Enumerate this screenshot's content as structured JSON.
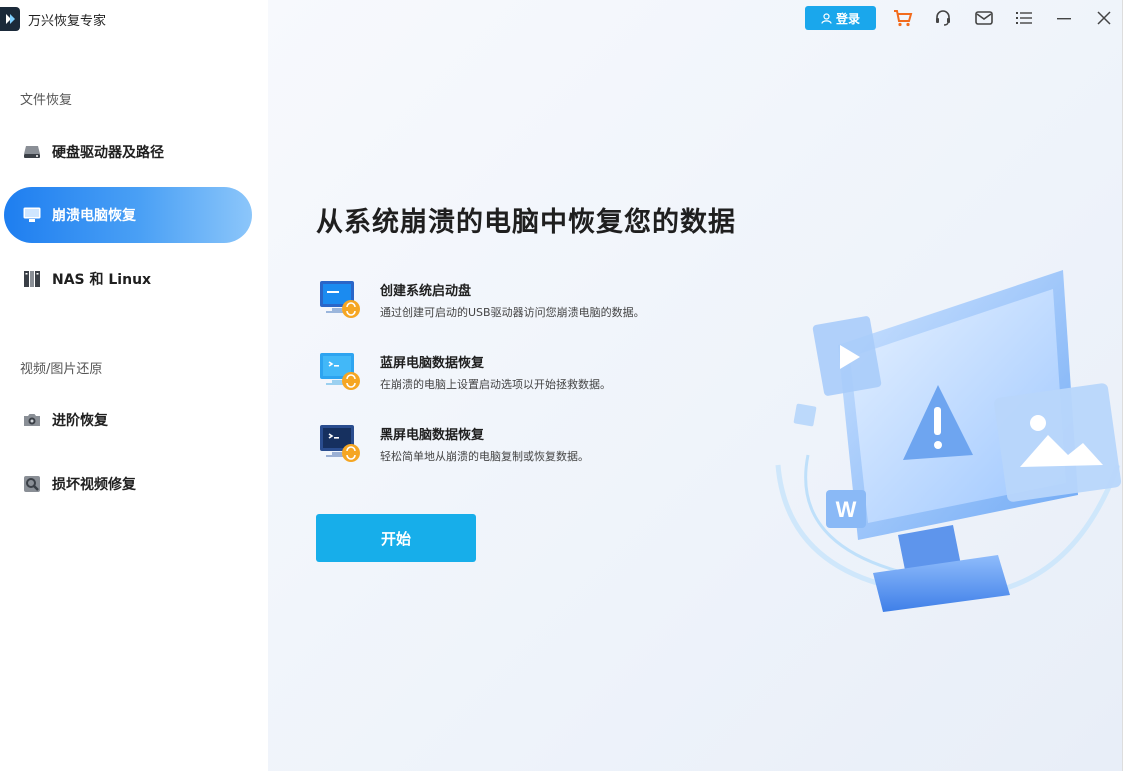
{
  "app": {
    "title": "万兴恢复专家"
  },
  "sidebar": {
    "section_file": "文件恢复",
    "section_media": "视频/图片还原",
    "items": [
      {
        "label": "硬盘驱动器及路径",
        "icon": "hard-drive-icon"
      },
      {
        "label": "崩溃电脑恢复",
        "icon": "monitor-icon",
        "active": true
      },
      {
        "label": "NAS 和 Linux",
        "icon": "nas-icon"
      },
      {
        "label": "进阶恢复",
        "icon": "camera-icon"
      },
      {
        "label": "损坏视频修复",
        "icon": "video-repair-icon"
      }
    ]
  },
  "topbar": {
    "login_label": "登录",
    "icons": [
      "cart-icon",
      "headset-icon",
      "mail-icon",
      "menu-icon",
      "minimize-icon",
      "close-icon"
    ]
  },
  "main": {
    "headline": "从系统崩溃的电脑中恢复您的数据",
    "options": [
      {
        "title": "创建系统启动盘",
        "desc": "通过创建可启动的USB驱动器访问您崩溃电脑的数据。"
      },
      {
        "title": "蓝屏电脑数据恢复",
        "desc": "在崩溃的电脑上设置启动选项以开始拯救数据。"
      },
      {
        "title": "黑屏电脑数据恢复",
        "desc": "轻松简单地从崩溃的电脑复制或恢复数据。"
      }
    ],
    "start_label": "开始",
    "illustration_badge": "W"
  },
  "colors": {
    "accent": "#1aa7ec",
    "active_nav": "#1e7ef0"
  }
}
